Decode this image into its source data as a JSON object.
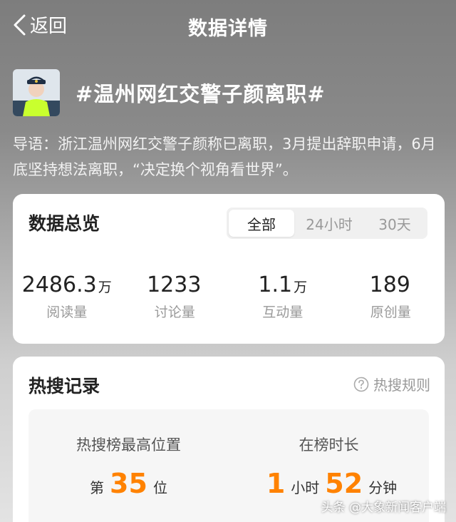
{
  "header": {
    "back_label": "返回",
    "title": "数据详情"
  },
  "topic": {
    "name": "#温州网红交警子颜离职#"
  },
  "intro": {
    "text": "导语：浙江温州网红交警子颜称已离职，3月提出辞职申请，6月底坚持想法离职，“决定换个视角看世界”。"
  },
  "overview": {
    "title": "数据总览",
    "tabs": [
      {
        "label": "全部",
        "active": true
      },
      {
        "label": "24小时"
      },
      {
        "label": "30天"
      }
    ],
    "stats": [
      {
        "value": "2486.3",
        "unit": "万",
        "label": "阅读量"
      },
      {
        "value": "1233",
        "unit": "",
        "label": "讨论量"
      },
      {
        "value": "1.1",
        "unit": "万",
        "label": "互动量"
      },
      {
        "value": "189",
        "unit": "",
        "label": "原创量"
      }
    ]
  },
  "hot": {
    "title": "热搜记录",
    "rules_label": "热搜规则",
    "rank": {
      "caption": "热搜榜最高位置",
      "prefix": "第",
      "value": "35",
      "suffix": "位"
    },
    "duration": {
      "caption": "在榜时长",
      "hours": "1",
      "hours_unit": "小时",
      "minutes": "52",
      "minutes_unit": "分钟"
    }
  },
  "watermark": "头条 @大象新闻客户端",
  "colors": {
    "accent": "#ff8200"
  }
}
